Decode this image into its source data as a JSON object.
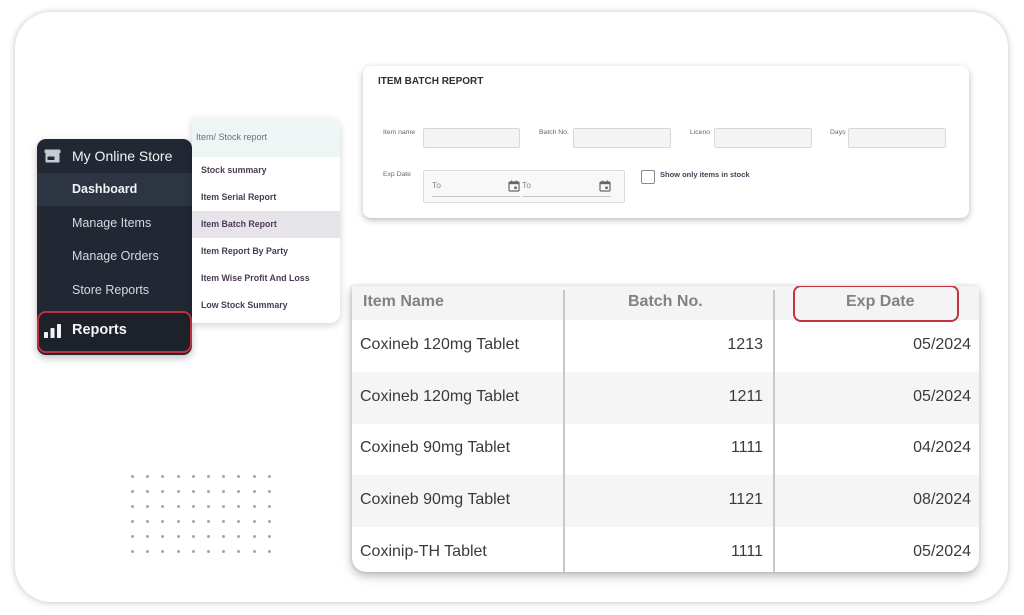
{
  "sidebar": {
    "store_title": "My Online Store",
    "store_icon": "storefront-icon",
    "items": [
      {
        "label": "Dashboard",
        "active": true
      },
      {
        "label": "Manage Items",
        "active": false
      },
      {
        "label": "Manage Orders",
        "active": false
      },
      {
        "label": "Store Reports",
        "active": false
      }
    ],
    "reports": {
      "label": "Reports",
      "icon": "bar-chart-icon",
      "highlighted": true
    }
  },
  "submenu": {
    "heading": "Item/ Stock report",
    "items": [
      {
        "label": "Stock summary",
        "active": false
      },
      {
        "label": "Item Serial Report",
        "active": false
      },
      {
        "label": "Item Batch Report",
        "active": true
      },
      {
        "label": "Item Report By Party",
        "active": false
      },
      {
        "label": "Item Wise Profit And Loss",
        "active": false
      },
      {
        "label": "Low Stock Summary",
        "active": false
      }
    ]
  },
  "filter": {
    "title": "ITEM BATCH REPORT",
    "item_name_label": "Item name",
    "item_name_value": "",
    "batch_no_label": "Batch No.",
    "batch_no_value": "",
    "liceno_label": "Liceno",
    "liceno_value": "",
    "days_label": "Days",
    "days_value": "",
    "exp_date_label": "Exp Date",
    "date_from_placeholder": "To",
    "date_to_placeholder": "To",
    "calendar_icon": "calendar-icon",
    "show_in_stock_label": "Show only items in stock",
    "show_in_stock_checked": false
  },
  "table": {
    "columns": [
      "Item Name",
      "Batch No.",
      "Exp Date"
    ],
    "highlighted_column": "Exp Date",
    "rows": [
      {
        "item_name": "Coxineb 120mg Tablet",
        "batch_no": "1213",
        "exp_date": "05/2024"
      },
      {
        "item_name": "Coxineb 120mg Tablet",
        "batch_no": "1211",
        "exp_date": "05/2024"
      },
      {
        "item_name": "Coxineb 90mg Tablet",
        "batch_no": "1111",
        "exp_date": "04/2024"
      },
      {
        "item_name": "Coxineb 90mg Tablet",
        "batch_no": "1121",
        "exp_date": "08/2024"
      },
      {
        "item_name": "Coxinip-TH Tablet",
        "batch_no": "1111",
        "exp_date": "05/2024"
      }
    ]
  },
  "colors": {
    "sidebar_bg": "#222833",
    "highlight_red": "#c8323c",
    "submenu_text": "#4b3b55"
  }
}
